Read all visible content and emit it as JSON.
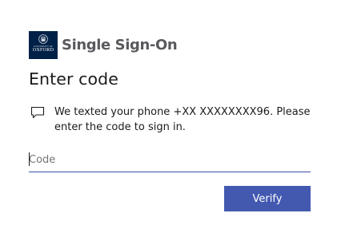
{
  "branding": {
    "crest_small_text": "UNIVERSITY OF",
    "crest_text": "OXFORD",
    "product_name": "Single Sign-On",
    "crest_color": "#002147"
  },
  "page": {
    "title": "Enter code",
    "message": "We texted your phone +XX XXXXXXXX96. Please enter the code to sign in.",
    "message_icon": "message-icon"
  },
  "form": {
    "code_placeholder": "Code",
    "code_value": "",
    "verify_label": "Verify",
    "accent_color": "#4359b0"
  }
}
